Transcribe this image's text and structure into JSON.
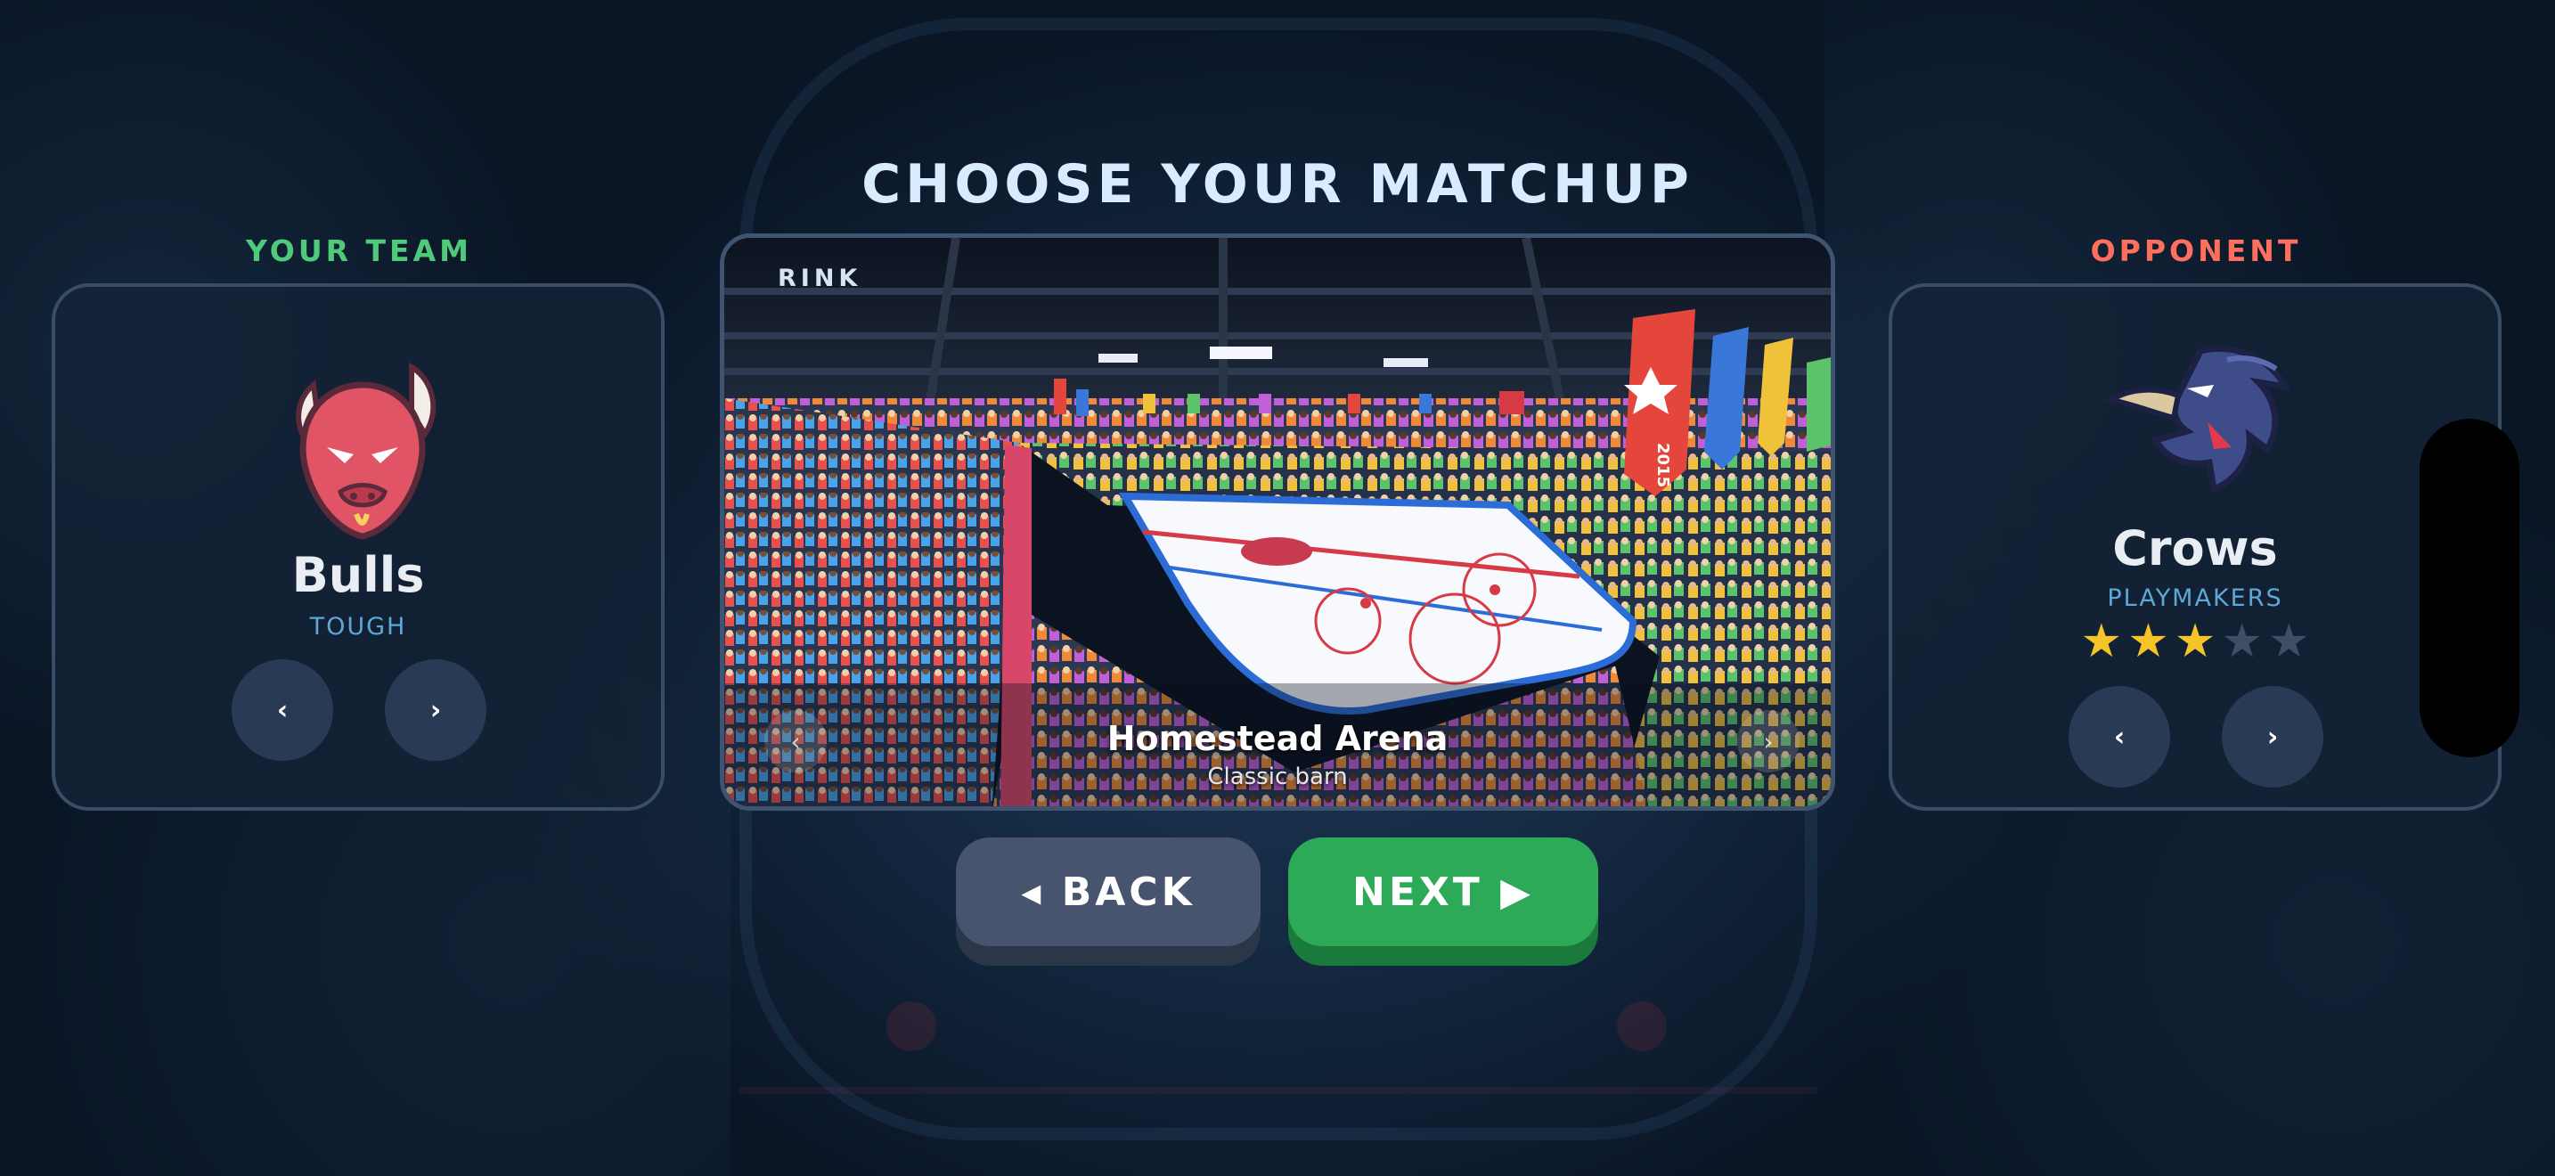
{
  "title": "CHOOSE YOUR MATCHUP",
  "colors": {
    "your_team_label": "#4fc97a",
    "opponent_label": "#ff6f5e",
    "star_filled": "#f6c429",
    "star_empty": "#3d4e66",
    "next_button": "#2daa57",
    "back_button": "#46546e"
  },
  "your_team": {
    "label": "YOUR TEAM",
    "logo_icon": "bull-mascot-icon",
    "name": "Bulls",
    "style": "TOUGH",
    "prev_symbol": "‹",
    "next_symbol": "›"
  },
  "opponent": {
    "label": "OPPONENT",
    "logo_icon": "crow-mascot-icon",
    "name": "Crows",
    "style": "PLAYMAKERS",
    "rating": 3,
    "rating_max": 5,
    "prev_symbol": "‹",
    "next_symbol": "›"
  },
  "rink": {
    "tag": "RINK",
    "arena_name": "Homestead Arena",
    "arena_subtitle": "Classic barn",
    "prev_symbol": "‹",
    "next_symbol": "›",
    "banner_text": "2015"
  },
  "buttons": {
    "back": "◂ BACK",
    "next": "NEXT ▶"
  }
}
